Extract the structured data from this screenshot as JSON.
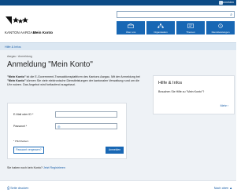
{
  "topbar": {
    "account_label": "Anmelden"
  },
  "header": {
    "logo_text": "KANTON AARGAU",
    "brand": "Mein Konto",
    "search": {
      "placeholder": ""
    }
  },
  "nav": [
    {
      "label": "Über uns"
    },
    {
      "label": "Organisation"
    },
    {
      "label": "Themen"
    },
    {
      "label": "Dienstleistungen"
    }
  ],
  "helpband": {
    "link": "Hilfe & Infos"
  },
  "breadcrumb": {
    "home": "Aargau",
    "separator": "/",
    "current": "Anmeldung"
  },
  "page": {
    "title": "Anmeldung \"Mein Konto\"",
    "intro_bold": "\"Mein Konto\"",
    "intro_1": " ist die E-Government-Transaktionsplattform des Kantons Aargau. Mit der Anmeldung bei ",
    "intro_bold_2": "\"Mein Konto\"",
    "intro_2": " können Sie viele elektronische Dienstleistungen der kantonalen Verwaltung rund um die Uhr nutzen. Das Angebot wird fortlaufend ausgebaut."
  },
  "form": {
    "email_label": "E-Mail oder ID *",
    "email_value": "",
    "password_label": "Passwort *",
    "password_value": "",
    "required_note": "* Pflichtfeldern",
    "forgot_button": "Passwort vergessen?",
    "login_button": "Anmelden"
  },
  "noaccount": {
    "text": "Sie haben noch kein Konto?",
    "link": "Jetzt Registrieren"
  },
  "aside": {
    "title": "Hilfe & Infos",
    "text": "Brauchen Sie Hilfe zu \"Mein Konto\"?",
    "more": "Mehr"
  },
  "footer": {
    "print": "Seite drucken",
    "to_top": "Nach oben"
  },
  "colors": {
    "brand_blue": "#1867b4",
    "top_blue": "#0c4b86",
    "link_blue": "#1a5fa8"
  }
}
